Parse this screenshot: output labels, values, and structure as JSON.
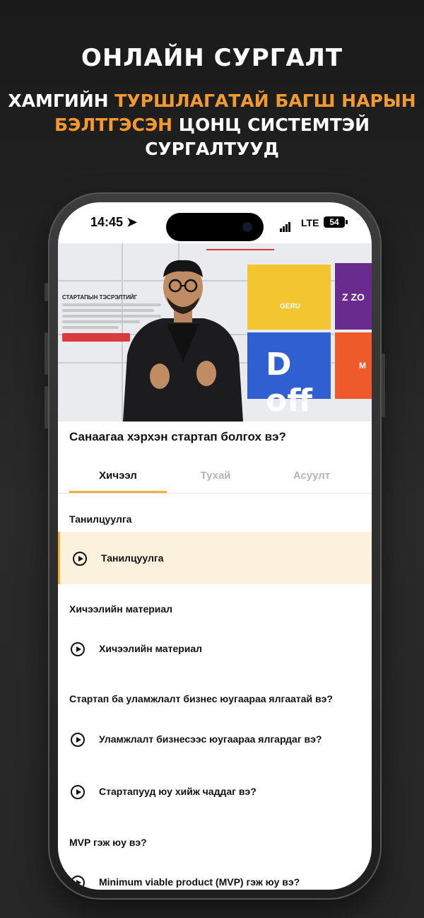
{
  "promo": {
    "headline": "ОНЛАЙН СУРГАЛТ",
    "sub_part1": "ХАМГИЙН ",
    "sub_highlight1": "ТУРШЛАГАТАЙ БАГШ НАРЫН",
    "sub_highlight2": "БЭЛТГЭСЭН",
    "sub_part2": " ЦОНЦ СИСТЕМТЭЙ",
    "sub_part3": "СУРГАЛТУУД"
  },
  "status_bar": {
    "time": "14:45",
    "network": "LTE",
    "battery": "54"
  },
  "video": {
    "slide_title": "СТАРТАПЫН ТЭСРЭЛТИЙГ",
    "tiles": [
      {
        "label": "GERU",
        "color": "#f2c531"
      },
      {
        "label": "Z ZO",
        "color": "#6a2b8f"
      },
      {
        "label": "D off",
        "color": "#2f5fd0"
      },
      {
        "label": "M",
        "color": "#ee5a2a"
      }
    ]
  },
  "lesson": {
    "title": "Санаагаа хэрхэн стартап болгох вэ?"
  },
  "tabs": [
    {
      "label": "Хичээл"
    },
    {
      "label": "Тухай"
    },
    {
      "label": "Асуулт"
    }
  ],
  "sections": [
    {
      "heading": "Танилцуулга",
      "items": [
        "Танилцуулга"
      ]
    },
    {
      "heading": "Хичээлийн материал",
      "items": [
        "Хичээлийн материал"
      ]
    },
    {
      "heading": "Стартап ба уламжлалт бизнес юугаараа ялгаатай вэ?",
      "items": [
        "Уламжлалт бизнесээс юугаараа ялгардаг вэ?",
        "Стартапууд юу хийж чаддаг вэ?"
      ]
    },
    {
      "heading": "MVP гэж юу вэ?",
      "items": [
        "Minimum viable product (MVP) гэж юу вэ?"
      ]
    }
  ],
  "colors": {
    "accent": "#f2b233",
    "highlight_text": "#f29a2e"
  }
}
